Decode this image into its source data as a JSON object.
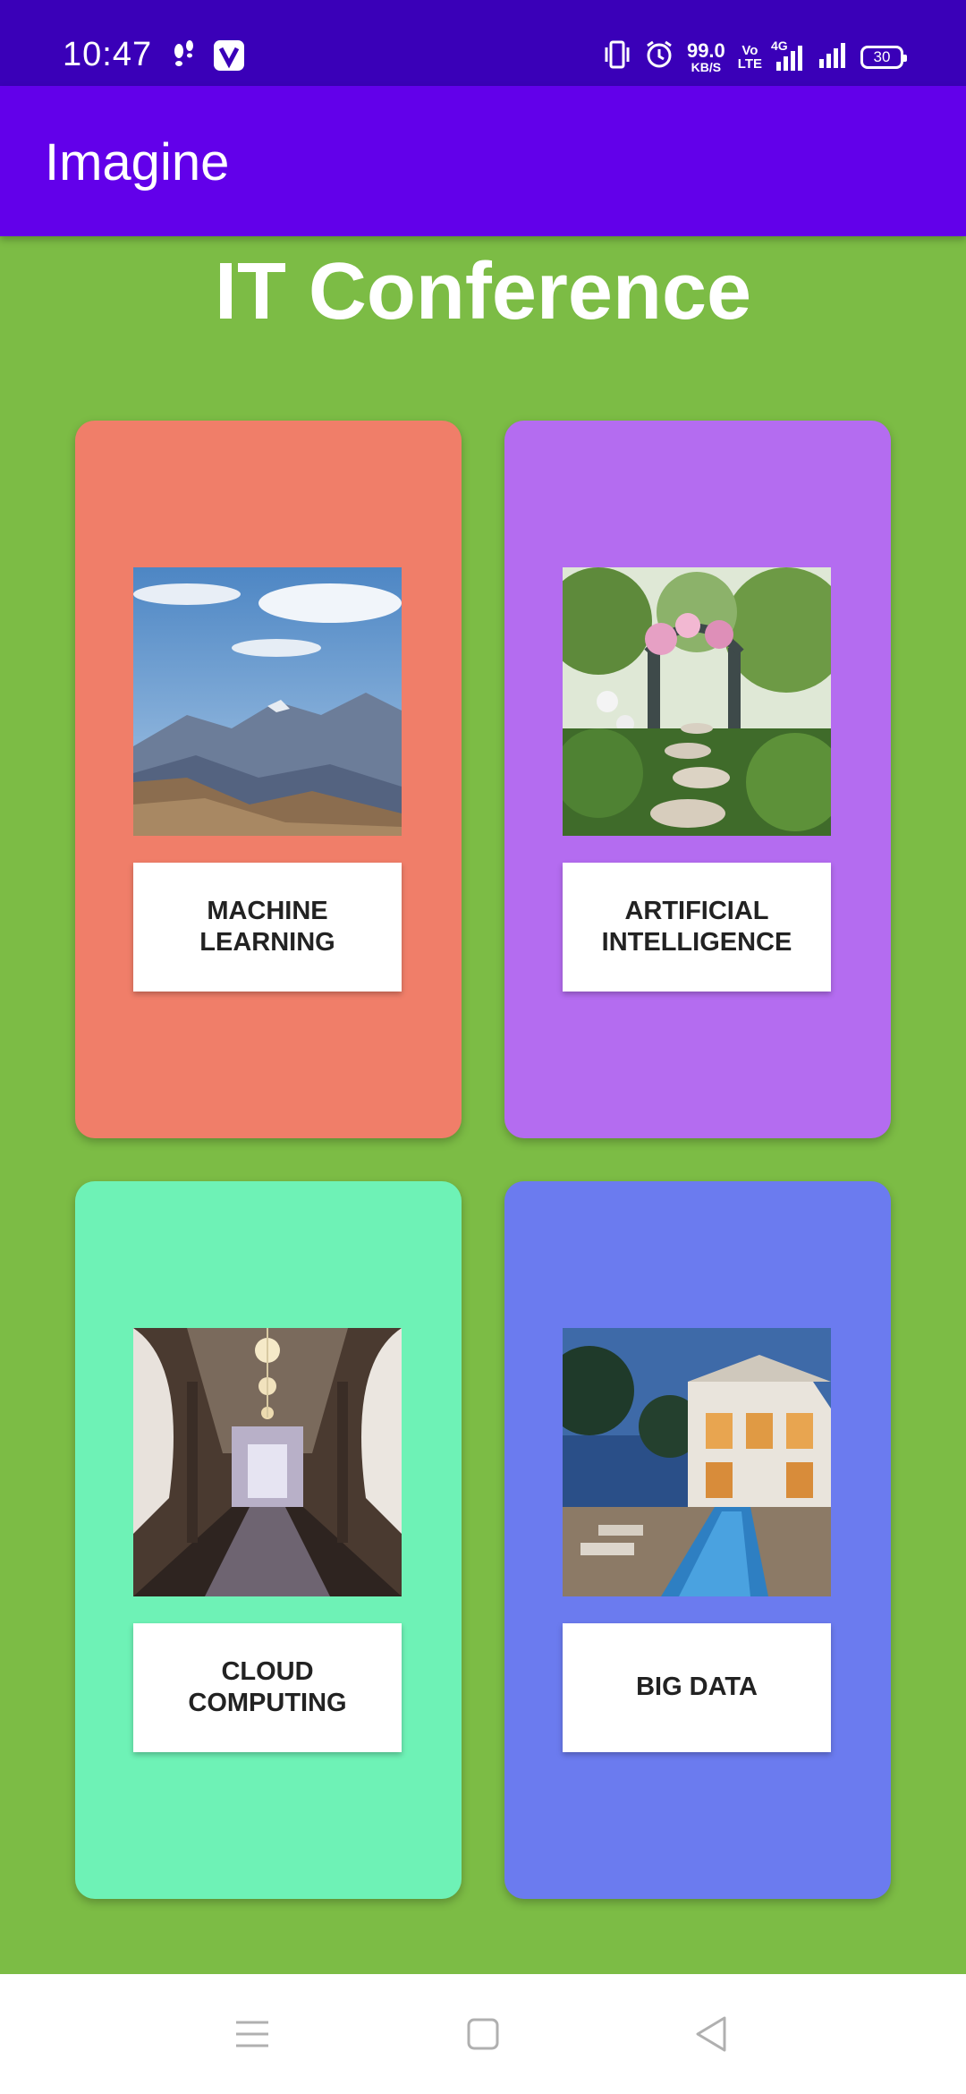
{
  "status_bar": {
    "time": "10:47",
    "net_speed": "99.0",
    "net_speed_unit": "KB/S",
    "volte_top": "Vo",
    "volte_bottom": "LTE",
    "network": "4G",
    "battery": "30",
    "icons": [
      "footsteps-icon",
      "vpn-v-icon",
      "vibrate-icon",
      "alarm-icon",
      "signal-icon",
      "signal-icon",
      "battery-icon"
    ],
    "background": "#3a00b8"
  },
  "app_bar": {
    "title": "Imagine",
    "background": "#6200ea"
  },
  "page": {
    "heading": "IT Conference",
    "background": "#7cbc45"
  },
  "cards": [
    {
      "label": "MACHINE\nLEARNING",
      "image": "mountain-landscape",
      "color": "#f07e69"
    },
    {
      "label": "ARTIFICIAL\nINTELLIGENCE",
      "image": "garden-path",
      "color": "#b46cf0"
    },
    {
      "label": "CLOUD\nCOMPUTING",
      "image": "chandelier-hall",
      "color": "#6ef2b6"
    },
    {
      "label": "BIG DATA",
      "image": "pool-villa",
      "color": "#6b7bef"
    }
  ],
  "nav_bar": {
    "icons": [
      "menu-icon",
      "home-square-icon",
      "back-triangle-icon"
    ]
  }
}
